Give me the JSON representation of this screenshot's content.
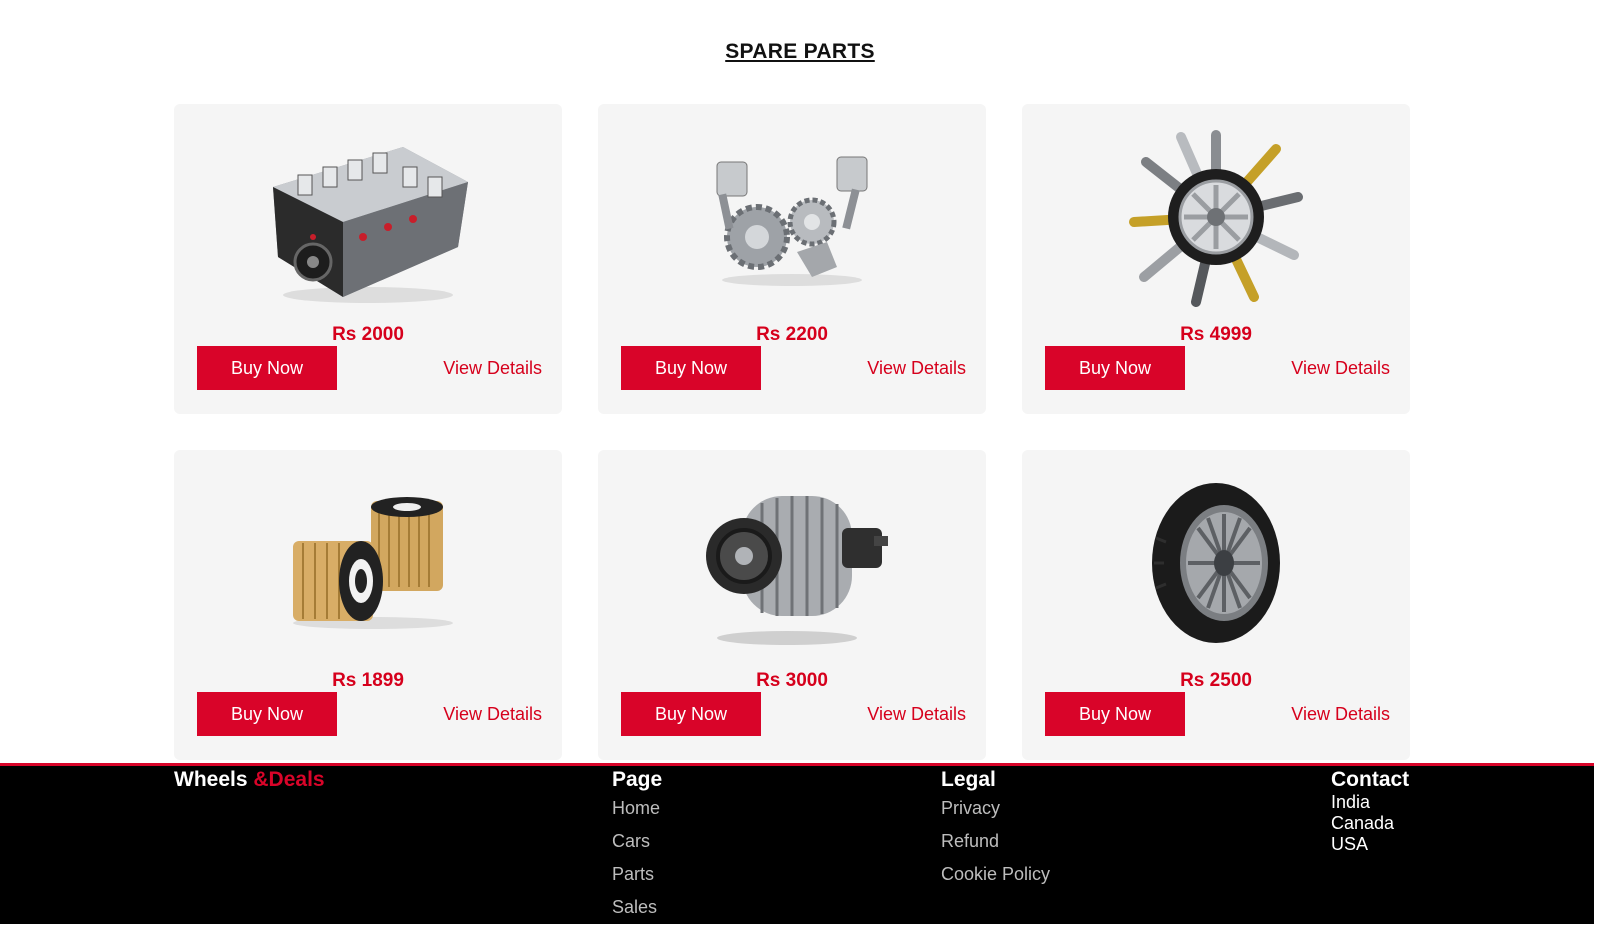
{
  "section": {
    "title": "SPARE PARTS"
  },
  "products": [
    {
      "price": "Rs 2000",
      "buy_label": "Buy Now",
      "details_label": "View Details",
      "image": "engine-block"
    },
    {
      "price": "Rs 2200",
      "buy_label": "Buy Now",
      "details_label": "View Details",
      "image": "pistons-gears"
    },
    {
      "price": "Rs 4999",
      "buy_label": "Buy Now",
      "details_label": "View Details",
      "image": "wheel-parts-burst"
    },
    {
      "price": "Rs 1899",
      "buy_label": "Buy Now",
      "details_label": "View Details",
      "image": "oil-filters"
    },
    {
      "price": "Rs 3000",
      "buy_label": "Buy Now",
      "details_label": "View Details",
      "image": "alternator"
    },
    {
      "price": "Rs 2500",
      "buy_label": "Buy Now",
      "details_label": "View Details",
      "image": "tyre"
    }
  ],
  "footer": {
    "brand": {
      "part1": "Wheels",
      "part2": "&Deals"
    },
    "page": {
      "heading": "Page",
      "links": [
        "Home",
        "Cars",
        "Parts",
        "Sales"
      ]
    },
    "legal": {
      "heading": "Legal",
      "links": [
        "Privacy",
        "Refund",
        "Cookie Policy"
      ]
    },
    "contact": {
      "heading": "Contact",
      "items": [
        "India",
        "Canada",
        "USA"
      ]
    }
  },
  "colors": {
    "accent": "#d90429",
    "card_bg": "#f5f5f5",
    "footer_bg": "#000000"
  }
}
